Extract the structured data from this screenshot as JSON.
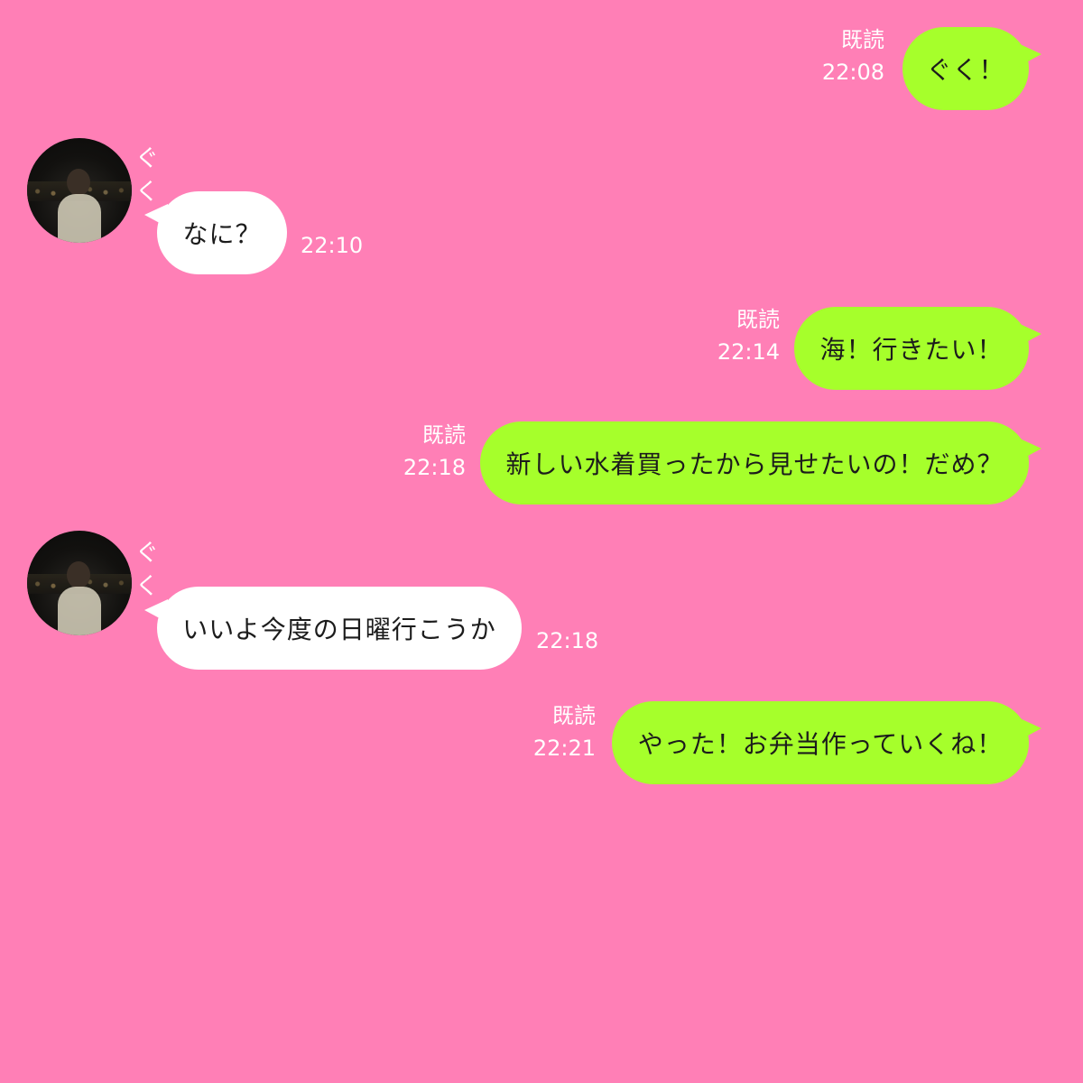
{
  "colors": {
    "background": "#ff7fb6",
    "my_bubble": "#a6ff2b",
    "their_bubble": "#ffffff",
    "meta_text": "#ffffff"
  },
  "contact": {
    "name": "ぐく",
    "avatar": "night-city-portrait"
  },
  "messages": [
    {
      "from": "me",
      "text": "ぐく！",
      "read": "既読",
      "time": "22:08"
    },
    {
      "from": "them",
      "sender": "ぐく",
      "text": "なに？",
      "time": "22:10"
    },
    {
      "from": "me",
      "text": "海！行きたい！",
      "read": "既読",
      "time": "22:14"
    },
    {
      "from": "me",
      "text": "新しい水着買ったから見せたいの！だめ？",
      "read": "既読",
      "time": "22:18"
    },
    {
      "from": "them",
      "sender": "ぐく",
      "text": "いいよ今度の日曜行こうか",
      "time": "22:18"
    },
    {
      "from": "me",
      "text": "やった！お弁当作っていくね！",
      "read": "既読",
      "time": "22:21"
    }
  ]
}
